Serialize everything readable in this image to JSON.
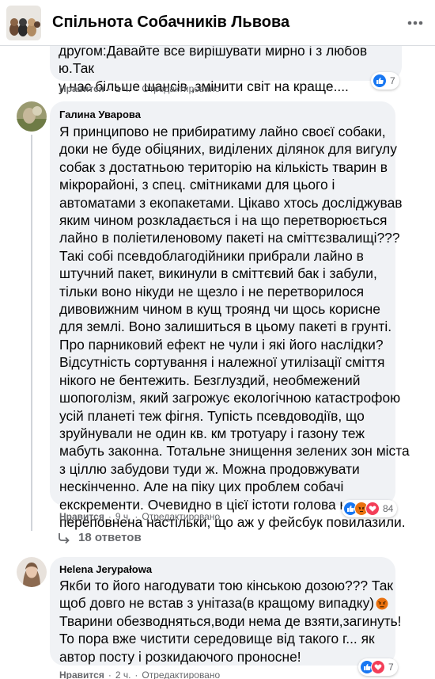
{
  "header": {
    "title": "Спільнота Собачників Львова",
    "avatar_icon": "dogs-group-avatar",
    "more_icon": "more-dots-icon"
  },
  "comment1": {
    "lines": [
      "другом:Давайте все вирішувати мирно і з любов ю.Так",
      "у нас більше шансів ,змінити світ на краще...."
    ],
    "like_label": "Нравится",
    "time": "1 ч.",
    "edited": "Отредактировано",
    "reaction_count": "7"
  },
  "comment2": {
    "author": "Галина Уварова",
    "lines": [
      "Я принципово не прибиратиму лайно своєї собаки,",
      "доки не буде обіцяних, виділених ділянок для вигулу",
      "собак з достатньою територію на кількість тварин в",
      "мікрорайоні, з спец. смітниками для цього і",
      "автоматами з екопакетами. Цікаво хтось досліджував",
      "яким чином розкладається і на що перетворюється",
      "лайно в поліетиленовому пакеті на сміттєзвалищі???",
      "Такі собі псевдоблагодійники прибрали лайно в",
      "штучний пакет, викинули в сміттєвий бак і забули,",
      "тільки воно нікуди не щезло і не перетворилося",
      "дивовижним чином в кущ троянд чи щось корисне",
      "для землі. Воно залишиться в цьому пакеті в грунті.",
      "Про парниковий ефект не чули і які його наслідки?",
      "Відсутність сортування і належної утилізації сміття",
      "нікого не бентежить. Безглуздий, необмежений",
      "шопоголізм, який загрожує екологічною катастрофою",
      "усій планеті теж фігня. Тупість псевдоводіїв, що",
      "зруйнували не один кв. км тротуару і газону теж",
      "мабуть законна. Тотальне знищення зелених зон міста",
      "з ціллю забудови туди ж. Можна продовжувати",
      "нескінченно. Але на піку цих проблем собачі",
      "екскременти. Очевидно в цієї істоти голова ними",
      "переповнена настільки, що аж у фейсбук повилазили."
    ],
    "like_label": "Нравится",
    "time": "9 ч.",
    "edited": "Отредактировано",
    "reaction_count": "84",
    "replies_label": "18 ответов"
  },
  "comment3": {
    "author": "Helena Jerypałowa",
    "lines": [
      "Якби то його нагодувати тою кінською дозою??? Так",
      "щоб довго не встав з унітаза(в кращому випадку)",
      "Тварини обезводняться,води нема де взяти,загинуть!",
      "То пора вже чистити середовище від такого г... як",
      "автор посту і розкидаючого проносне!"
    ],
    "like_label": "Нравится",
    "time": "2 ч.",
    "edited": "Отредактировано",
    "reaction_count": "7"
  },
  "colors": {
    "like_blue": "#1877f2",
    "love_red": "#f33e58",
    "angry_orange": "#e9710f",
    "bubble_bg": "#f0f2f5",
    "meta_gray": "#65676b"
  }
}
